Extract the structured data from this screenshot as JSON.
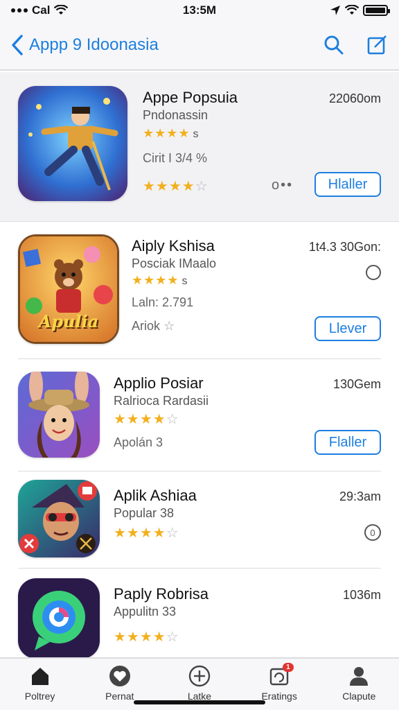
{
  "status": {
    "carrier": "Cal",
    "time": "13:5M"
  },
  "nav": {
    "back_label": "Appp 9 Idoonasia",
    "search_icon": "search-icon",
    "edit_icon": "compose-icon"
  },
  "colors": {
    "accent": "#1d7fe0",
    "star": "#f2b01e",
    "badge": "#e3342f"
  },
  "apps": [
    {
      "name": "Appe Popsuia",
      "subtitle": "Pndonassin",
      "rating_small": "s",
      "meta": "Cirit I 3/4 %",
      "size": "22060om",
      "stars": 4,
      "more_label": "o••",
      "button_label": "Hlaller"
    },
    {
      "name": "Aiply Kshisa",
      "subtitle": "Posciak IMaalo",
      "rating_small": "s",
      "meta": "Laln: 2.791",
      "meta2": "Ariok",
      "size": "1t4.3 30Gon:",
      "icon_text": "Apulia",
      "button_label": "Llever"
    },
    {
      "name": "Applio Posiar",
      "subtitle": "Ralrioca Rardasii",
      "meta": "Apolán 3",
      "size": "130Gem",
      "stars": 4,
      "button_label": "Flaller"
    },
    {
      "name": "Aplik Ashiaa",
      "subtitle": "Popular 38",
      "size": "29:3am",
      "stars": 4,
      "info_label": "0"
    },
    {
      "name": "Paply Robrisa",
      "subtitle": "Appulitn 33",
      "size": "1036m",
      "stars": 4
    }
  ],
  "tabs": [
    {
      "label": "Poltrey",
      "icon": "home-icon"
    },
    {
      "label": "Pernat",
      "icon": "heart-icon"
    },
    {
      "label": "Latke",
      "icon": "plus-circle-icon"
    },
    {
      "label": "Eratings",
      "icon": "updates-icon",
      "badge": "1"
    },
    {
      "label": "Clapute",
      "icon": "person-icon"
    }
  ]
}
